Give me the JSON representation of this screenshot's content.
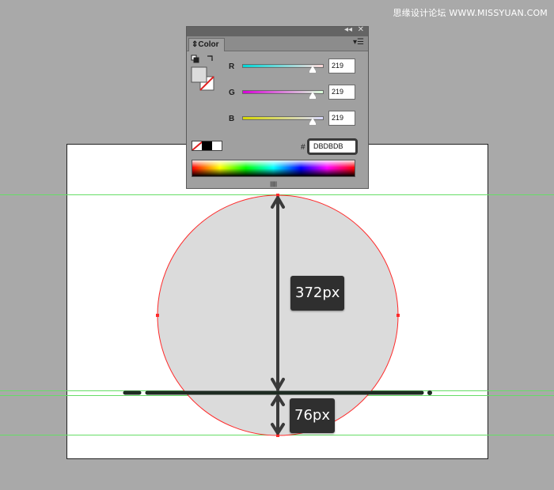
{
  "watermark": "思缘设计论坛 WWW.MISSYUAN.COM",
  "canvas": {
    "fill_color": "#DBDBDB",
    "outline_color": "#ff2a2a",
    "guide_color": "#66dd66",
    "bar_color": "#1e2b22",
    "arrow_color": "#3a3a3a",
    "measurements": {
      "circle_diameter": "372px",
      "lower_offset": "76px"
    }
  },
  "color_panel": {
    "titlebar": {
      "collapse_icon": "double-chevron-left-icon",
      "close_icon": "close-icon"
    },
    "tab_label": "Color",
    "menu_icon": "panel-menu-icon",
    "channels": [
      {
        "key": "r",
        "label": "R",
        "value": "219",
        "level": 0.86,
        "gradient": [
          "#00d8d8",
          "#ffd8d8"
        ]
      },
      {
        "key": "g",
        "label": "G",
        "value": "219",
        "level": 0.86,
        "gradient": [
          "#d800d8",
          "#d8ffd8"
        ]
      },
      {
        "key": "b",
        "label": "B",
        "value": "219",
        "level": 0.86,
        "gradient": [
          "#d8d800",
          "#d8d8ff"
        ]
      }
    ],
    "hex_label": "#",
    "hex_value": "DBDBDB",
    "swatches": [
      "none",
      "#000000",
      "#ffffff"
    ]
  }
}
